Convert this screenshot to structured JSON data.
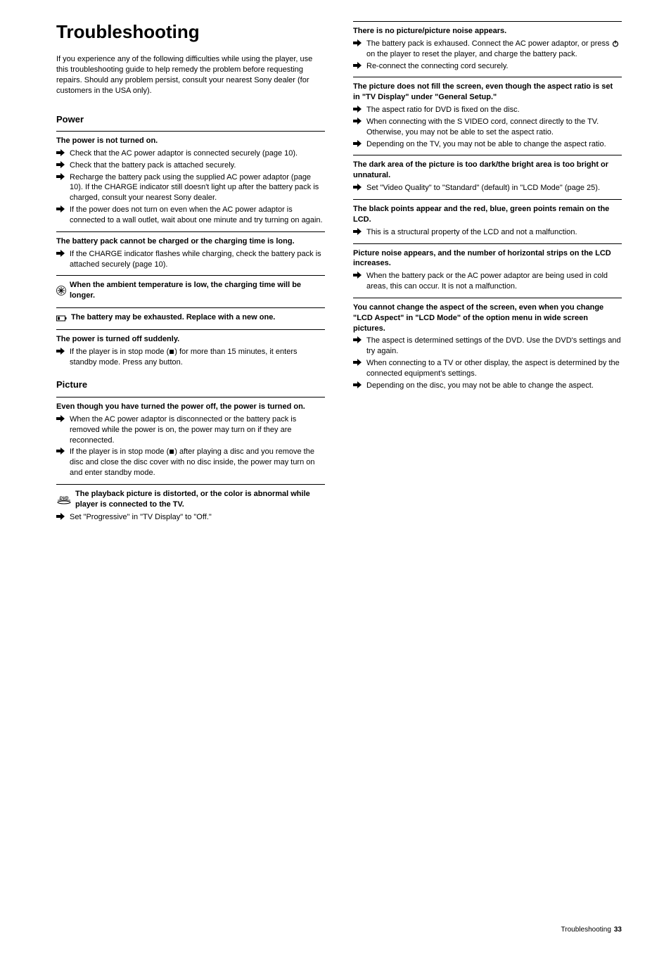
{
  "title": "Troubleshooting",
  "intro": "If you experience any of the following difficulties while using the player, use this troubleshooting guide to help remedy the problem before requesting repairs. Should any problem persist, consult your nearest Sony dealer (for customers in the USA only).",
  "section_power": "Power",
  "section_picture": "Picture",
  "entries_left": [
    {
      "head": "The power is not turned on.",
      "bullets": [
        "Check that the AC power adaptor is connected securely (page 10).",
        "Check that the battery pack is attached securely.",
        "Recharge the battery pack using the supplied AC power adaptor (page 10). If the CHARGE indicator still doesn't light up after the battery pack is charged, consult your nearest Sony dealer.",
        "If the power does not turn on even when the AC power adaptor is connected to a wall outlet, wait about one minute and try turning on again."
      ]
    },
    {
      "head": "The battery pack cannot be charged or the charging time is long.",
      "bullets": [
        "If the CHARGE indicator flashes while charging, check the battery pack is attached securely (page 10)."
      ]
    },
    {
      "head_icon": "snow",
      "head": "When the ambient temperature is low, the charging time will be longer."
    },
    {
      "head_icon": "battery",
      "head": "The battery may be exhausted. Replace with a new one."
    },
    {
      "head": "The power is turned off suddenly.",
      "bullets": [
        "If the player is in stop mode (■) for more than 15 minutes, it enters standby mode. Press any button."
      ]
    },
    {
      "head": "Even though you have turned the power off, the power is turned on.",
      "bullets": [
        "When the AC power adaptor is disconnected or the battery pack is removed while the power is on, the power may turn on if they are reconnected.",
        "If the player is in stop mode (■) after playing a disc and you remove the disc and close the disc cover with no disc inside, the power may turn on and enter standby mode."
      ]
    },
    {
      "head_icon": "dvd",
      "head": "The playback picture is distorted, or the color is abnormal while player is connected to the TV.",
      "bullets": [
        "Set \"Progressive\" in \"TV Display\" to \"Off.\""
      ]
    }
  ],
  "entries_right": [
    {
      "head": "There is no picture/picture noise appears.",
      "bullets": [
        {
          "text": "The battery pack is exhaused. Connect the AC power adaptor, or press ",
          "after_icon": " on the player to reset the player, and charge the battery pack.",
          "icon": "power"
        },
        "Re-connect the connecting cord securely."
      ]
    },
    {
      "head": "The picture does not fill the screen, even though the aspect ratio is set in \"TV Display\" under \"General Setup.\"",
      "bullets": [
        "The aspect ratio for DVD is fixed on the disc.",
        "When connecting with the S VIDEO cord, connect directly to the TV. Otherwise, you may not be able to set the aspect ratio.",
        "Depending on the TV, you may not be able to change the aspect ratio."
      ]
    },
    {
      "head": "The dark area of the picture is too dark/the bright area is too bright or unnatural.",
      "bullets": [
        "Set \"Video Quality\" to \"Standard\" (default) in \"LCD Mode\" (page 25)."
      ]
    },
    {
      "head": "The black points appear and the red, blue, green points remain on the LCD.",
      "bullets": [
        "This is a structural property of the LCD and not a malfunction."
      ]
    },
    {
      "head": "Picture noise appears, and the number of horizontal strips on the LCD increases.",
      "bullets": [
        "When the battery pack or the AC power adaptor are being used in cold areas, this can occur. It is not a malfunction."
      ]
    },
    {
      "head": "You cannot change the aspect of the screen, even when you change \"LCD Aspect\" in \"LCD Mode\" of the option menu in wide screen pictures.",
      "bullets": [
        "The aspect is determined settings of the DVD. Use the DVD's settings and try again.",
        "When connecting to a TV or other display, the aspect is determined by the connected equipment's settings.",
        "Depending on the disc, you may not be able to change the aspect."
      ]
    }
  ],
  "footer_label": "Troubleshooting",
  "footer_page": "33"
}
